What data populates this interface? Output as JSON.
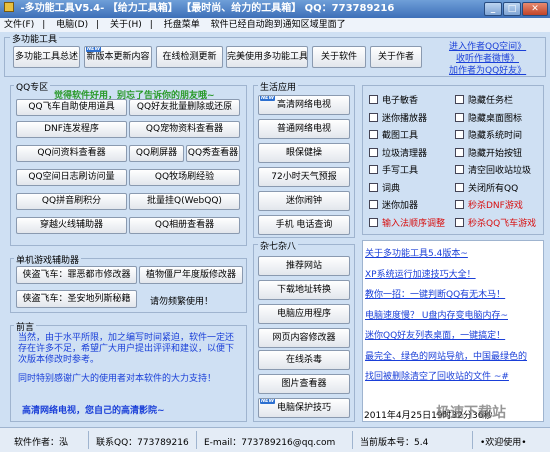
{
  "window": {
    "title": "-多功能工具V5.4-  【给力工具箱】  【最时尚、给力的工具箱】  QQ：773789216"
  },
  "menu": [
    "文件(F)",
    "电脑(D)",
    "关于(H)",
    "托盘菜单",
    "软件已经自动跑到通知区域里面了"
  ],
  "top_group": {
    "label": "多功能工具",
    "buttons": [
      "多功能工具总述",
      "新版本更新内容",
      "在线检测更新",
      "完美使用多功能工具",
      "关于软件",
      "关于作者"
    ],
    "links": [
      "进入作者QQ空间》",
      "收听作者微博》",
      "加作者为QQ好友》"
    ]
  },
  "qq_group": {
    "label": "QQ专区",
    "banner": "觉得软件好用，别忘了告诉你的朋友哦~",
    "buttons": [
      "QQ飞车自助使用道具",
      "QQ好友批量删除或还原",
      "DNF连发程序",
      "QQ宠物资料查看器",
      "QQ问资料查看器",
      "QQ刷屏器",
      "QQ秀查看器",
      "QQ空间日志刷访问量",
      "QQ牧场刷经验",
      "QQ拼音刷积分",
      "批量挂Q(WebQQ)",
      "穿越火线辅助器",
      "QQ相册查看器"
    ]
  },
  "life_group": {
    "label": "生活应用",
    "buttons": [
      "高清网络电视",
      "普通网络电视",
      "眼保健操",
      "72小时天气预报",
      "迷你闹钟",
      "手机 电话查询"
    ]
  },
  "checkboxes": [
    {
      "label": "电子敏香",
      "red": false
    },
    {
      "label": "隐藏任务栏",
      "red": false
    },
    {
      "label": "迷你播放器",
      "red": false
    },
    {
      "label": "隐藏桌面图标",
      "red": false
    },
    {
      "label": "截图工具",
      "red": false
    },
    {
      "label": "隐藏系统时间",
      "red": false
    },
    {
      "label": "垃圾清理器",
      "red": false
    },
    {
      "label": "隐藏开始按钮",
      "red": false
    },
    {
      "label": "手写工具",
      "red": false
    },
    {
      "label": "清空回收站垃圾",
      "red": false
    },
    {
      "label": "词典",
      "red": false
    },
    {
      "label": "关闭所有QQ",
      "red": false
    },
    {
      "label": "迷你加器",
      "red": false
    },
    {
      "label": "秒杀DNF游戏",
      "red": true
    },
    {
      "label": "输入法顺序调整",
      "red": true
    },
    {
      "label": "秒杀QQ飞车游戏",
      "red": true
    }
  ],
  "single_group": {
    "label": "单机游戏辅助器",
    "buttons": [
      "侠盗飞车：罪恶都市修改器",
      "植物僵尸年度版修改器",
      "侠盗飞车：圣安地列斯秘籍",
      "请勿频繁使用！"
    ]
  },
  "misc_group": {
    "label": "杂七杂八",
    "buttons": [
      "推荐网站",
      "下载地址转换",
      "电脑应用程序",
      "网页内容修改器",
      "在线杀毒",
      "图片查看器",
      "电脑保护技巧"
    ]
  },
  "foreword": {
    "label": "前言",
    "text": "当然，由于水平所限，加之编写时间紧迫，软件一定还存在许多不足，希望广大用户提出评评和建议，以便下次版本修改时参考。",
    "thanks": "同时特别感谢广大的使用者对本软件的大力支持！"
  },
  "tv_line": "高清网络电视，您自己的高清影院~",
  "news_links": [
    "关于多功能工具5.4版本~",
    "XP系统运行加速技巧大全！",
    "教你一招：一键判断QQ有无木马！",
    "电脑速度慢？ U盘内存变电脑内存~",
    "迷你QQ好友列表桌面，一键搞定！",
    "最完全、绿色的网站导航，中国最绿色的",
    "找回被删除清空了回收站的文件 ~#"
  ],
  "datetime": "2011年4月25日19时32分36秒",
  "watermark": "极速下载站",
  "status": {
    "author": "软件作者：泓",
    "contact": "联系QQ：773789216",
    "email": "E-mail：773789216@qq.com",
    "version": "当前版本号：5.4",
    "welcome": "•欢迎使用•"
  },
  "colors": {
    "banner": "#2a9a2a",
    "red": "#d81010",
    "link": "#1a3fd8",
    "tv": "#1a3fd8"
  }
}
